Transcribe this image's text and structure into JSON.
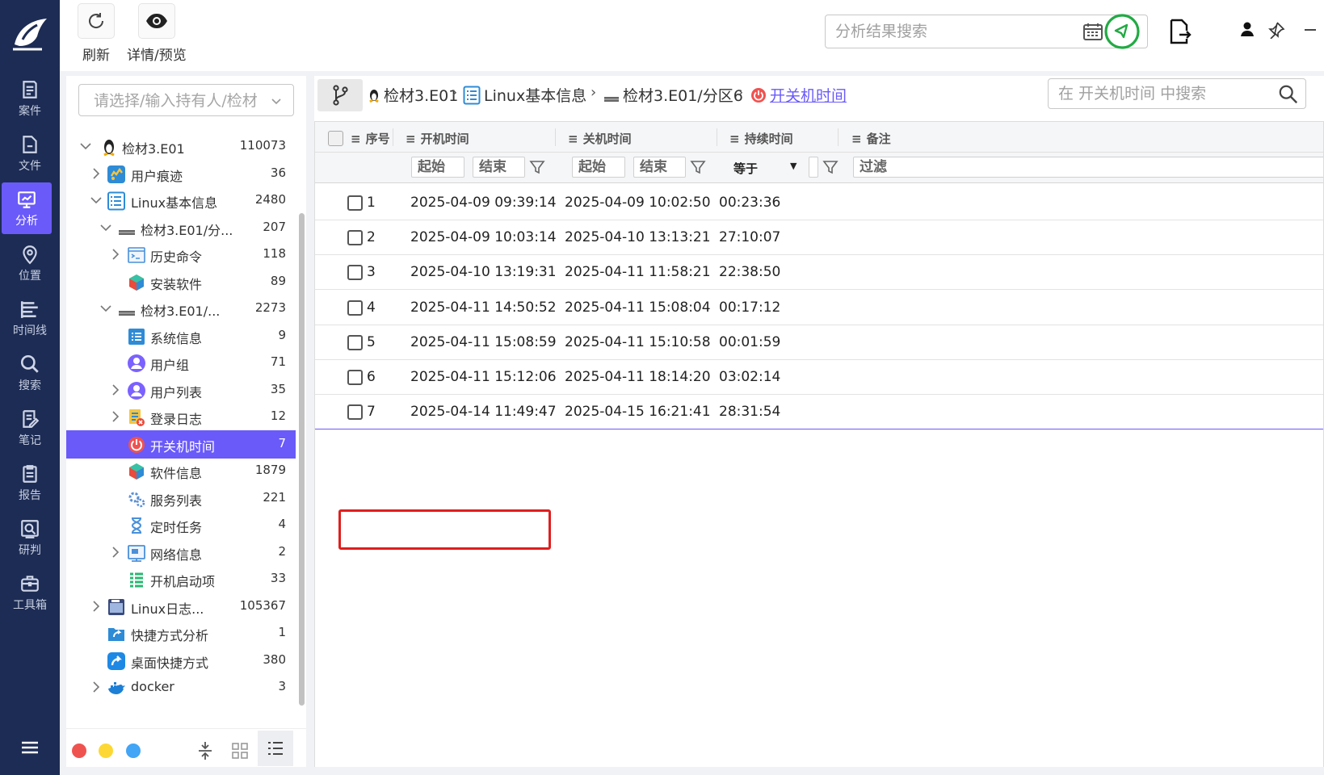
{
  "nav": {
    "items": [
      {
        "label": "案件",
        "icon": "case-icon"
      },
      {
        "label": "文件",
        "icon": "file-icon"
      },
      {
        "label": "分析",
        "icon": "analysis-icon",
        "active": true
      },
      {
        "label": "位置",
        "icon": "location-icon"
      },
      {
        "label": "时间线",
        "icon": "timeline-icon"
      },
      {
        "label": "搜索",
        "icon": "search-icon"
      },
      {
        "label": "笔记",
        "icon": "note-icon"
      },
      {
        "label": "报告",
        "icon": "report-icon"
      },
      {
        "label": "研判",
        "icon": "judge-icon"
      },
      {
        "label": "工具箱",
        "icon": "toolbox-icon"
      }
    ]
  },
  "toolbar": {
    "refresh_label": "刷新",
    "preview_label": "详情/预览",
    "search_placeholder": "分析结果搜索"
  },
  "colors": {
    "accent": "#6a5af9",
    "rail": "#1d2c54",
    "highlight": "#e01e1e",
    "ok": "#22aa44"
  },
  "tree": {
    "owner_placeholder": "请选择/输入持有人/检材",
    "items": [
      {
        "label": "检材3.E01",
        "count": "110073",
        "icon": "linux-penguin-icon",
        "expander": "expanded"
      },
      {
        "label": "用户痕迹",
        "count": "36",
        "icon": "user-trace-icon",
        "expander": "collapsed"
      },
      {
        "label": "Linux基本信息",
        "count": "2480",
        "icon": "list-icon",
        "expander": "expanded"
      },
      {
        "label": "检材3.E01/分...",
        "count": "207",
        "icon": "disk-icon",
        "expander": "expanded"
      },
      {
        "label": "历史命令",
        "count": "118",
        "icon": "terminal-icon",
        "expander": "collapsed"
      },
      {
        "label": "安装软件",
        "count": "89",
        "icon": "package-icon",
        "expander": "none"
      },
      {
        "label": "检材3.E01/...",
        "count": "2273",
        "icon": "disk-icon",
        "expander": "expanded"
      },
      {
        "label": "系统信息",
        "count": "9",
        "icon": "system-info-icon",
        "expander": "none"
      },
      {
        "label": "用户组",
        "count": "71",
        "icon": "user-group-icon",
        "expander": "none"
      },
      {
        "label": "用户列表",
        "count": "35",
        "icon": "user-list-icon",
        "expander": "collapsed"
      },
      {
        "label": "登录日志",
        "count": "12",
        "icon": "login-log-icon",
        "expander": "collapsed"
      },
      {
        "label": "开关机时间",
        "count": "7",
        "icon": "power-icon",
        "expander": "none",
        "selected": true
      },
      {
        "label": "软件信息",
        "count": "1879",
        "icon": "package-icon",
        "expander": "none"
      },
      {
        "label": "服务列表",
        "count": "221",
        "icon": "service-gear-icon",
        "expander": "none"
      },
      {
        "label": "定时任务",
        "count": "4",
        "icon": "hourglass-icon",
        "expander": "none"
      },
      {
        "label": "网络信息",
        "count": "2",
        "icon": "network-icon",
        "expander": "collapsed"
      },
      {
        "label": "开机启动项",
        "count": "33",
        "icon": "startup-list-icon",
        "expander": "none"
      },
      {
        "label": "Linux日志...",
        "count": "105367",
        "icon": "log-icon",
        "expander": "collapsed"
      },
      {
        "label": "快捷方式分析",
        "count": "1",
        "icon": "shortcut-folder-icon",
        "expander": "none"
      },
      {
        "label": "桌面快捷方式",
        "count": "380",
        "icon": "desktop-shortcut-icon",
        "expander": "none"
      },
      {
        "label": "docker",
        "count": "3",
        "icon": "docker-icon",
        "expander": "collapsed"
      }
    ]
  },
  "breadcrumb": {
    "items": [
      "检材3.E01",
      "Linux基本信息",
      "检材3.E01/分区6",
      "开关机时间"
    ],
    "search_placeholder": "在 开关机时间 中搜索"
  },
  "table": {
    "columns": [
      "序号",
      "开机时间",
      "关机时间",
      "持续时间",
      "备注"
    ],
    "filters": {
      "start": "起始",
      "end": "结束",
      "op": "等于",
      "remark": "过滤"
    },
    "rows": [
      {
        "no": "1",
        "boot": "2025-04-09 09:39:14",
        "shutdown": "2025-04-09 10:02:50",
        "duration": "00:23:36"
      },
      {
        "no": "2",
        "boot": "2025-04-09 10:03:14",
        "shutdown": "2025-04-10 13:13:21",
        "duration": "27:10:07"
      },
      {
        "no": "3",
        "boot": "2025-04-10 13:19:31",
        "shutdown": "2025-04-11 11:58:21",
        "duration": "22:38:50"
      },
      {
        "no": "4",
        "boot": "2025-04-11 14:50:52",
        "shutdown": "2025-04-11 15:08:04",
        "duration": "00:17:12"
      },
      {
        "no": "5",
        "boot": "2025-04-11 15:08:59",
        "shutdown": "2025-04-11 15:10:58",
        "duration": "00:01:59"
      },
      {
        "no": "6",
        "boot": "2025-04-11 15:12:06",
        "shutdown": "2025-04-11 18:14:20",
        "duration": "03:02:14"
      },
      {
        "no": "7",
        "boot": "2025-04-14 11:49:47",
        "shutdown": "2025-04-15 16:21:41",
        "duration": "28:31:54"
      }
    ]
  }
}
